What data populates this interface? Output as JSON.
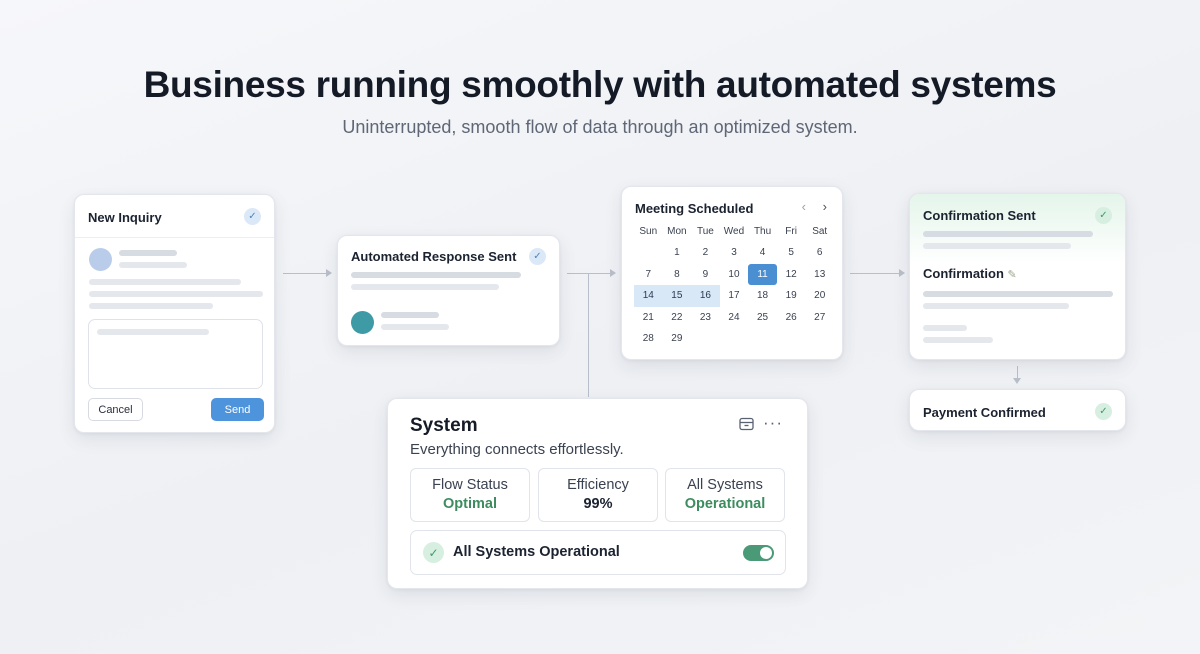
{
  "hero": {
    "title": "Business running smoothly with automated systems",
    "subtitle": "Uninterrupted, smooth flow of data through an optimized system."
  },
  "inquiry": {
    "title": "New Inquiry",
    "cancel_label": "Cancel",
    "send_label": "Send",
    "icon": "check-icon"
  },
  "auto_response": {
    "title": "Automated Response Sent",
    "icon": "check-icon"
  },
  "calendar": {
    "title": "Meeting Scheduled",
    "prev_icon": "chevron-left-icon",
    "next_icon": "chevron-right-icon",
    "weekdays": [
      "Sun",
      "Mon",
      "Tue",
      "Wed",
      "Thu",
      "Fri",
      "Sat"
    ],
    "leading_blanks": 1,
    "days": [
      "1",
      "2",
      "3",
      "4",
      "5",
      "6",
      "7",
      "8",
      "9",
      "10",
      "11",
      "12",
      "13",
      "14",
      "15",
      "16",
      "17",
      "18",
      "19",
      "20",
      "21",
      "22",
      "23",
      "24",
      "25",
      "26",
      "27",
      "28",
      "29"
    ],
    "selected_day": "11",
    "range_days": [
      "14",
      "15",
      "16"
    ]
  },
  "confirmation": {
    "title": "Confirmation Sent",
    "subtitle": "Confirmation",
    "subtitle_icon": "pencil-icon"
  },
  "payment": {
    "title": "Payment Confirmed"
  },
  "system": {
    "title": "System",
    "subtitle": "Everything connects effortlessly.",
    "icons": [
      "archive-icon",
      "more-icon"
    ],
    "stats": [
      {
        "label": "Flow Status",
        "value": "Optimal"
      },
      {
        "label": "Efficiency",
        "value": "99%"
      },
      {
        "label": "All Systems",
        "value": "Operational"
      }
    ],
    "status_text": "All Systems Operational",
    "toggle_on": true
  },
  "colors": {
    "accent_blue": "#4d94dd",
    "success_green": "#3d8c5f",
    "toggle_green": "#4a9a78"
  }
}
